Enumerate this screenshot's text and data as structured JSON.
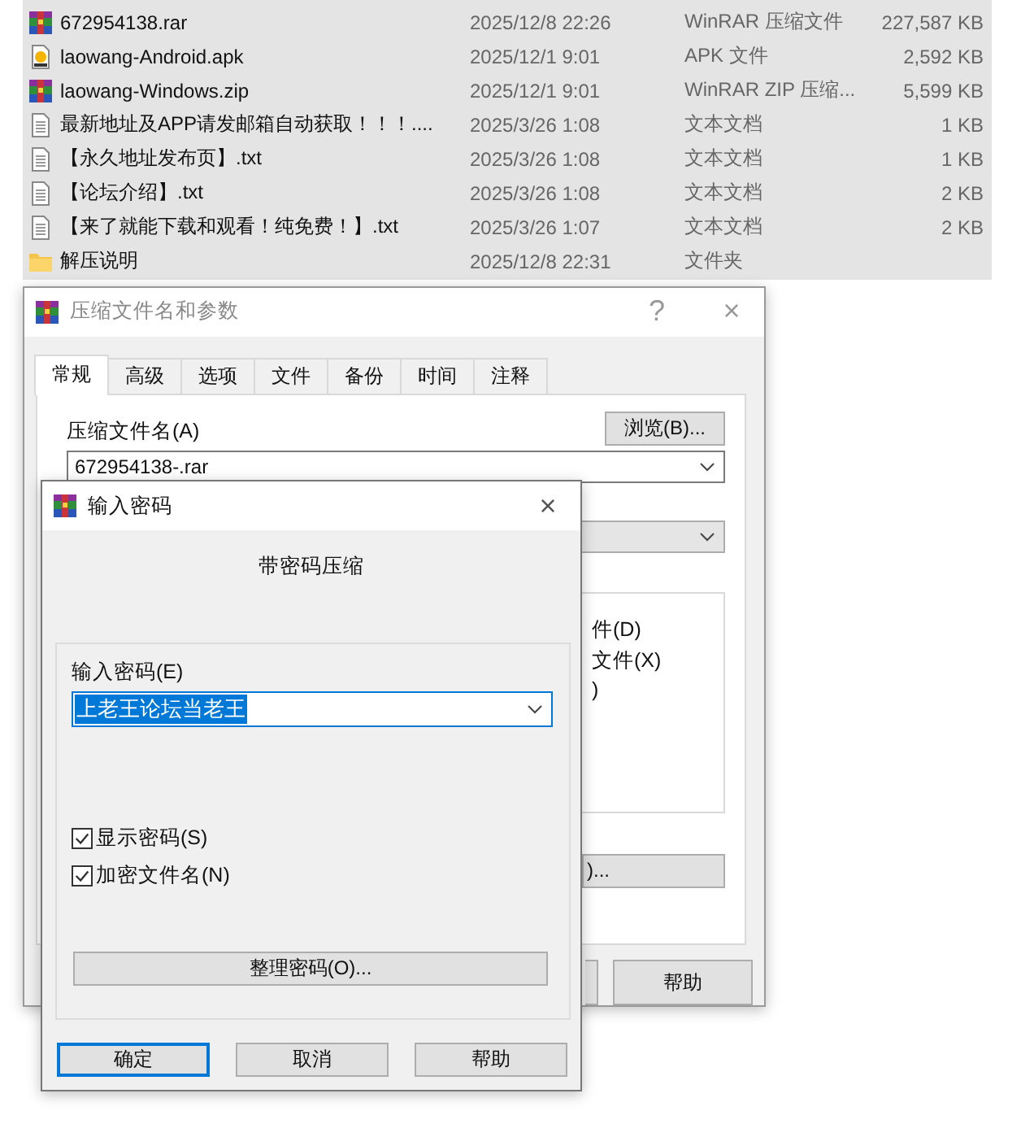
{
  "file_list": {
    "rows": [
      {
        "kind": "rar",
        "name": "672954138.rar",
        "modified": "2025/12/8 22:26",
        "type": "WinRAR 压缩文件",
        "size": "227,587 KB",
        "selected": true
      },
      {
        "kind": "apk",
        "name": "laowang-Android.apk",
        "modified": "2025/12/1 9:01",
        "type": "APK 文件",
        "size": "2,592 KB",
        "selected": true
      },
      {
        "kind": "rar",
        "name": "laowang-Windows.zip",
        "modified": "2025/12/1 9:01",
        "type": "WinRAR ZIP 压缩...",
        "size": "5,599 KB",
        "selected": true
      },
      {
        "kind": "txt",
        "name": "最新地址及APP请发邮箱自动获取！！！....",
        "modified": "2025/3/26 1:08",
        "type": "文本文档",
        "size": "1 KB",
        "selected": true
      },
      {
        "kind": "txt",
        "name": "【永久地址发布页】.txt",
        "modified": "2025/3/26 1:08",
        "type": "文本文档",
        "size": "1 KB",
        "selected": true
      },
      {
        "kind": "txt",
        "name": "【论坛介绍】.txt",
        "modified": "2025/3/26 1:08",
        "type": "文本文档",
        "size": "2 KB",
        "selected": true
      },
      {
        "kind": "txt",
        "name": "【来了就能下载和观看！纯免费！】.txt",
        "modified": "2025/3/26 1:07",
        "type": "文本文档",
        "size": "2 KB",
        "selected": true
      },
      {
        "kind": "folder",
        "name": "解压说明",
        "modified": "2025/12/8 22:31",
        "type": "文件夹",
        "size": "",
        "selected": true
      }
    ]
  },
  "archive_dialog": {
    "title": "压缩文件名和参数",
    "help_glyph": "?",
    "close_glyph": "×",
    "tabs": [
      {
        "label": "常规",
        "selected": true
      },
      {
        "label": "高级",
        "selected": false
      },
      {
        "label": "选项",
        "selected": false
      },
      {
        "label": "文件",
        "selected": false
      },
      {
        "label": "备份",
        "selected": false
      },
      {
        "label": "时间",
        "selected": false
      },
      {
        "label": "注释",
        "selected": false
      }
    ],
    "filename_label": "压缩文件名(A)",
    "browse_button": "浏览(B)...",
    "filename_value": "672954138-.rar",
    "partial_options": [
      "件(D)",
      "文件(X)",
      ")"
    ],
    "partial_button": ")...",
    "help_button": "帮助"
  },
  "password_dialog": {
    "title": "输入密码",
    "close_glyph": "×",
    "heading": "带密码压缩",
    "password_label": "输入密码(E)",
    "password_value": "上老王论坛当老王",
    "checkboxes": [
      {
        "label": "显示密码(S)",
        "checked": true
      },
      {
        "label": "加密文件名(N)",
        "checked": true
      }
    ],
    "manage_button": "整理密码(O)...",
    "buttons": [
      {
        "label": "确定",
        "default": true
      },
      {
        "label": "取消",
        "default": false
      },
      {
        "label": "帮助",
        "default": false
      }
    ]
  }
}
